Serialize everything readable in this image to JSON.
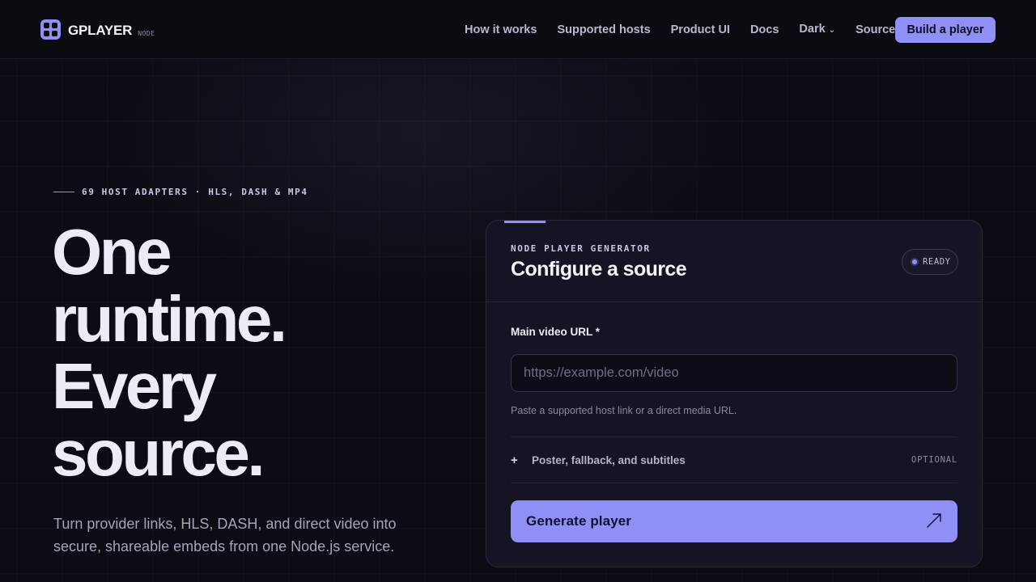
{
  "nav": {
    "brand_name": "GPLAYER",
    "brand_tag": "NODE",
    "links": [
      {
        "label": "How it works"
      },
      {
        "label": "Supported hosts"
      },
      {
        "label": "Product UI"
      },
      {
        "label": "Docs"
      },
      {
        "label": "Dark",
        "icon": "chevron-down-icon"
      },
      {
        "label": "Source"
      }
    ],
    "cta_label": "Build a player"
  },
  "hero": {
    "eyebrow": "69 HOST ADAPTERS · HLS, DASH & MP4",
    "headline_lines": [
      "One",
      "runtime.",
      "Every",
      "source."
    ],
    "subtitle": "Turn provider links, HLS, DASH, and direct video into secure, shareable embeds from one Node.js service."
  },
  "card": {
    "kicker": "NODE PLAYER GENERATOR",
    "title": "Configure a source",
    "status": "READY",
    "field_label": "Main video URL *",
    "url_value": "",
    "url_placeholder": "https://example.com/video",
    "hint": "Paste a supported host link or a direct media URL.",
    "expander_label": "Poster, fallback, and subtitles",
    "expander_tag": "OPTIONAL",
    "expander_icon": "plus-icon",
    "generate_label": "Generate player",
    "generate_icon": "arrow-up-right-icon"
  },
  "colors": {
    "accent": "#8f8ff5",
    "background": "#0c0c14",
    "card": "#141424"
  }
}
